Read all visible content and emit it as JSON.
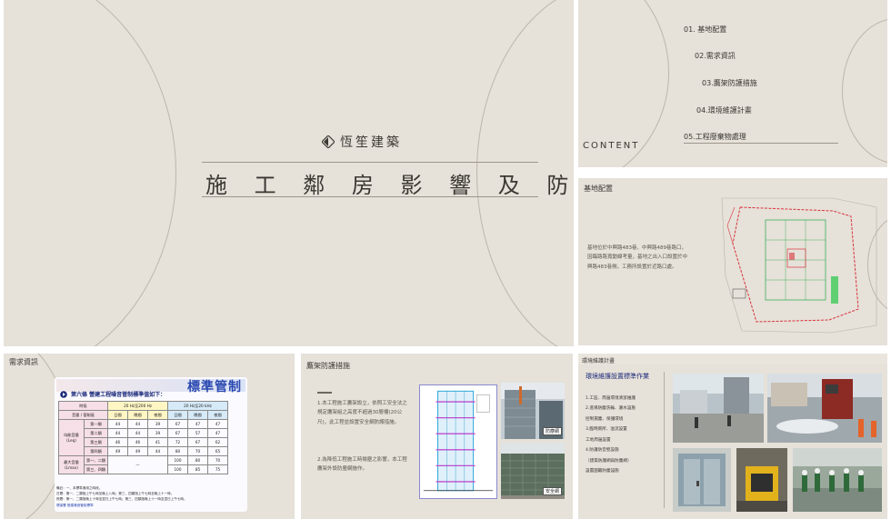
{
  "main_slide": {
    "brand": "恆笙建築",
    "title": "施 工 鄰 房 影 響 及 防 護 措 施"
  },
  "content_slide": {
    "label": "CONTENT",
    "items": [
      "01. 基地配置",
      "02.需求資訊",
      "03.鷹架防護措施",
      "04.環境維護計畫",
      "05.工程廢棄物處理"
    ]
  },
  "site_slide": {
    "title": "基地配置",
    "text": "基地位於中興路483巷、中興路489巷路口，因臨路路寬動線考量，基地之出入口設置於中興路483巷側，工務所設置於近路口處。"
  },
  "demand_slide": {
    "title": "需求資訊",
    "card_title": "標準管制",
    "card_subtitle": "第六條 營建工程噪音管制標準值如下：",
    "freq_low": "20 Hz至200 Hz",
    "freq_high": "20 Hz至20 kHz",
    "period_header": "時段",
    "volume_header": "音量",
    "zone_header": "管制區",
    "periods": [
      "日間",
      "晚間",
      "夜間",
      "日間",
      "晚間",
      "夜間"
    ],
    "leq_label": "均能音量(Leq)",
    "lmax_label": "最大音量(Lmax)",
    "rows": [
      {
        "zone": "第一類",
        "values": [
          "44",
          "44",
          "39",
          "67",
          "47",
          "47"
        ]
      },
      {
        "zone": "第二類",
        "values": [
          "44",
          "44",
          "39",
          "67",
          "57",
          "47"
        ]
      },
      {
        "zone": "第三類",
        "values": [
          "46",
          "46",
          "41",
          "72",
          "67",
          "62"
        ]
      },
      {
        "zone": "第四類",
        "values": [
          "49",
          "49",
          "44",
          "80",
          "70",
          "65"
        ]
      }
    ],
    "lmax_rows": [
      {
        "zone": "第一、二類",
        "low": "—",
        "values": [
          "100",
          "80",
          "70"
        ]
      },
      {
        "zone": "第三、四類",
        "low": "—",
        "values": [
          "100",
          "85",
          "75"
        ]
      }
    ],
    "notes": [
      "備註：一、本標準適用之時段。",
      "日間：第一、二類指上午七時至晚上八時；第三、四類指上午七時至晚上十一時。",
      "夜間：第一、二類指晚上十時至翌日上午七時；第三、四類指晚上十一時至翌日上午七時。"
    ],
    "footer": "環保署 營建噪音管制標準"
  },
  "scaffold_slide": {
    "title": "鷹架防護措施",
    "para1": "1.本工程施工鷹架設立，依照工安全法之規定鷹架組之高度不超過30層樓(20公尺)，此工程並設置安全網防護措施。",
    "para2": "2.為降低工程施工時揚塵之影響，本工程鷹架外設防塵網施作。",
    "label_top": "防塵網",
    "label_bottom": "安全網"
  },
  "env_slide": {
    "head": "環境維護計畫",
    "title": "環境維護設置標準作業",
    "items": [
      "1.工區、周邊環境清潔維護",
      "2.進場防塵洗輪、灑水設施",
      "  控制揚塵、保護環境",
      "3.臨時廁所、溢流設置",
      "  工地周邊設置",
      "4.防護防音壁設施",
      "（建築防護網與防塵網）",
      "  設置圍籬防塵設施"
    ]
  },
  "colors": {
    "slide_bg": "#e6e1d9",
    "accent_text": "#3b3833",
    "navy": "#1b2a7a"
  }
}
